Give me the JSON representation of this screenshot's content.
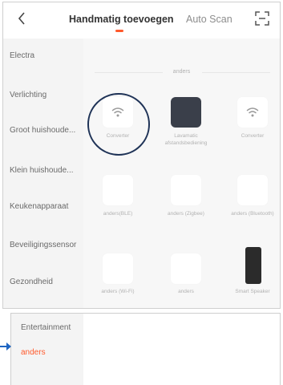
{
  "header": {
    "back_icon": "chevron-left-icon",
    "active_tab": "Handmatig toevoegen",
    "other_tab": "Auto Scan",
    "scan_icon": "scan-frame-icon",
    "accent": "#ff5a2c"
  },
  "sidebar": {
    "items": [
      {
        "label": "Electra"
      },
      {
        "label": "Verlichting"
      },
      {
        "label": "Groot huishoude..."
      },
      {
        "label": "Klein huishoude..."
      },
      {
        "label": "Keukenapparaat"
      },
      {
        "label": "Beveiligingssensor"
      },
      {
        "label": "Gezondheid"
      }
    ]
  },
  "content": {
    "group_title": "anders",
    "devices": [
      {
        "label": "Converter",
        "icon": "wifi-icon"
      },
      {
        "label": "Lavamatic afstandsbediening",
        "icon": "remote-icon"
      },
      {
        "label": "Converter",
        "icon": "wifi-icon"
      },
      {
        "label": "anders(BLE)",
        "icon": "device-icon"
      },
      {
        "label": "anders (Zigbee)",
        "icon": "device-icon"
      },
      {
        "label": "anders (Bluetooth)",
        "icon": "device-icon"
      },
      {
        "label": "anders (Wi-Fi)",
        "icon": "device-icon"
      },
      {
        "label": "anders",
        "icon": "device-icon"
      },
      {
        "label": "Smart Speaker",
        "icon": "speaker-icon"
      }
    ]
  },
  "bottom": {
    "items": [
      {
        "label": "Entertainment"
      },
      {
        "label": "anders"
      }
    ],
    "arrow_color": "#1f66c2"
  }
}
